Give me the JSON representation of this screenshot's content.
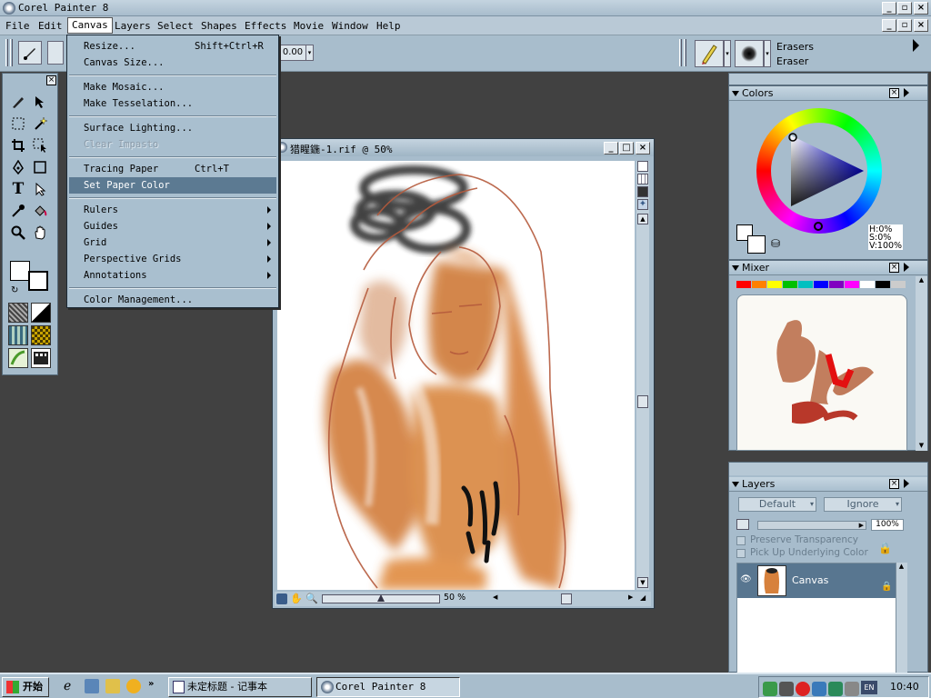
{
  "app": {
    "title": "Corel Painter 8"
  },
  "menubar": {
    "items": [
      "File",
      "Edit",
      "Canvas",
      "Layers",
      "Select",
      "Shapes",
      "Effects",
      "Movie",
      "Window",
      "Help"
    ],
    "active": "Canvas"
  },
  "canvas_menu": {
    "items": [
      {
        "label": "Resize...",
        "shortcut": "Shift+Ctrl+R"
      },
      {
        "label": "Canvas Size..."
      },
      {
        "label": "Make Mosaic..."
      },
      {
        "label": "Make Tesselation..."
      },
      {
        "label": "Surface Lighting..."
      },
      {
        "label": "Clear Impasto",
        "disabled": true
      },
      {
        "label": "Tracing Paper",
        "shortcut": "Ctrl+T"
      },
      {
        "label": "Set Paper Color",
        "highlighted": true
      },
      {
        "label": "Rulers",
        "submenu": true
      },
      {
        "label": "Guides",
        "submenu": true
      },
      {
        "label": "Grid",
        "submenu": true
      },
      {
        "label": "Perspective Grids",
        "submenu": true
      },
      {
        "label": "Annotations",
        "submenu": true
      },
      {
        "label": "Color Management..."
      }
    ]
  },
  "toolbar": {
    "value_field": "0.00",
    "brush_category": "Erasers",
    "brush_variant": "Eraser"
  },
  "document": {
    "title": "猎睲鍦-1.rif @ 50%",
    "zoom": "50 %"
  },
  "colors_panel": {
    "title": "Colors",
    "h": "H:0%",
    "s": "S:0%",
    "v": "V:100%"
  },
  "mixer_panel": {
    "title": "Mixer",
    "swatches": [
      "#ff0000",
      "#ff8000",
      "#ffff00",
      "#00c000",
      "#00c0c0",
      "#0000ff",
      "#8000c0",
      "#ff00ff",
      "#ffffff",
      "#000000",
      "#cccccc"
    ]
  },
  "layers_panel": {
    "title": "Layers",
    "composite_method": "Default",
    "depth_method": "Ignore",
    "opacity": "100%",
    "preserve_transparency": "Preserve Transparency",
    "pick_up_color": "Pick Up Underlying Color",
    "layer_name": "Canvas"
  },
  "taskbar": {
    "start": "开始",
    "tasks": [
      "未定标题 - 记事本",
      "Corel Painter 8"
    ],
    "clock": "10:40",
    "ime": "EN"
  },
  "colors": {
    "chrome": "#a8bdcc",
    "desktop": "#414141",
    "menu_highlight": "#5c7a92"
  }
}
